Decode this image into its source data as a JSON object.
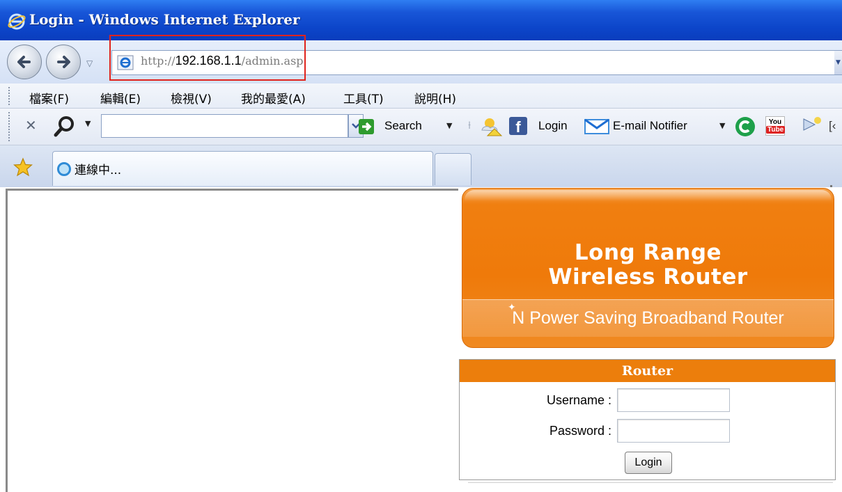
{
  "window": {
    "title": "Login - Windows Internet Explorer"
  },
  "address_bar": {
    "url_protocol": "http://",
    "url_host": "192.168.1.1",
    "url_path": "/admin.asp",
    "highlight_color": "#e0231c"
  },
  "menu": {
    "items": [
      "檔案(F)",
      "編輯(E)",
      "檢視(V)",
      "我的最愛(A)",
      "工具(T)",
      "說明(H)"
    ]
  },
  "search_toolbar": {
    "search_value": "",
    "search_label": "Search",
    "facebook_label": "Login",
    "email_label": "E-mail Notifier",
    "overflow_text": "[‹",
    "icons": [
      "close-icon",
      "magnifier-icon",
      "green-arrow-icon",
      "weather-icon",
      "facebook-icon",
      "mail-icon",
      "green-c-icon",
      "youtube-icon",
      "misc-icon"
    ]
  },
  "tabs": {
    "active_label": "連線中..."
  },
  "banner": {
    "title_line1": "Long Range",
    "title_line2": "Wireless Router",
    "subtitle": "N Power Saving Broadband Router",
    "color": "#ef7a0a"
  },
  "login": {
    "header": "Router",
    "username_label": "Username :",
    "username_value": "",
    "password_label": "Password :",
    "password_value": "",
    "button_label": "Login",
    "header_color": "#ec7e0c"
  }
}
